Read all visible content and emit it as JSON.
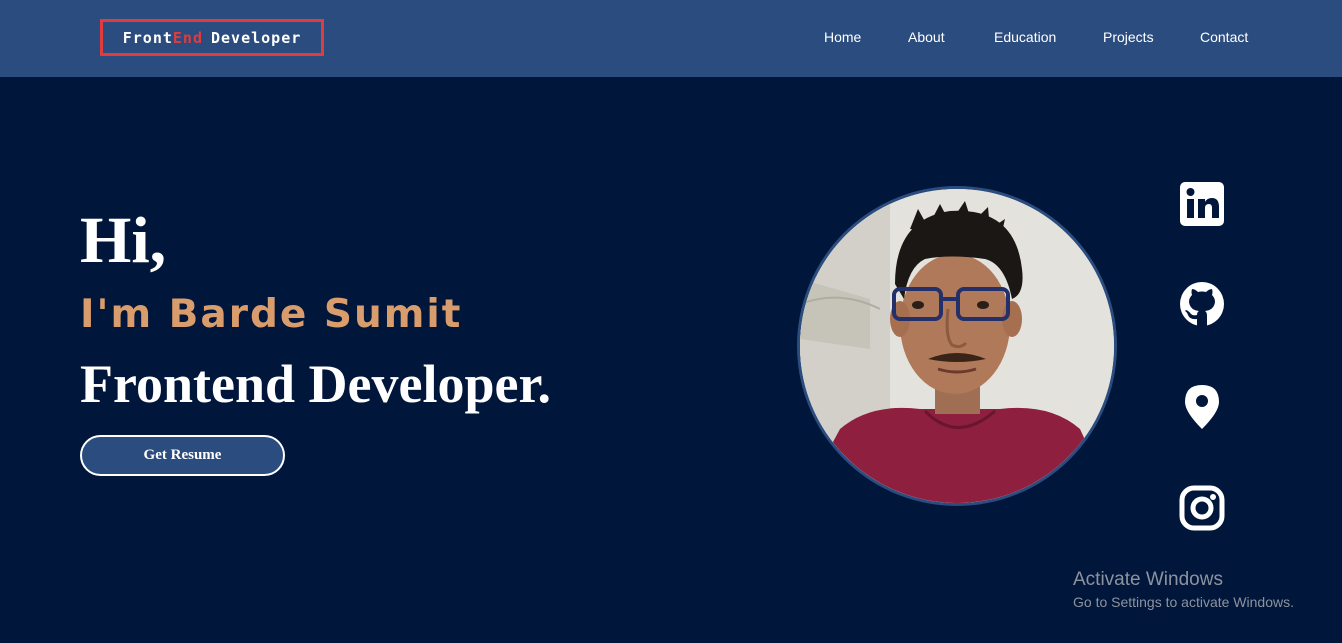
{
  "header": {
    "logo": {
      "part1": "Front",
      "part2": "End",
      "part3": "Developer"
    },
    "nav": [
      {
        "label": "Home"
      },
      {
        "label": "About"
      },
      {
        "label": "Education"
      },
      {
        "label": "Projects"
      },
      {
        "label": "Contact"
      }
    ]
  },
  "hero": {
    "greeting": "Hi,",
    "name": "I'm Barde Sumit",
    "role": "Frontend Developer.",
    "button_label": "Get Resume"
  },
  "social": [
    {
      "icon": "linkedin-icon"
    },
    {
      "icon": "github-icon"
    },
    {
      "icon": "location-pin-icon"
    },
    {
      "icon": "instagram-icon"
    }
  ],
  "watermark": {
    "title": "Activate Windows",
    "subtitle": "Go to Settings to activate Windows."
  },
  "colors": {
    "header_bg": "#2b4c7e",
    "page_bg": "#00163a",
    "logo_accent": "#e23b3b",
    "name_color": "#d99c6c",
    "button_bg": "#2b4c7e"
  }
}
